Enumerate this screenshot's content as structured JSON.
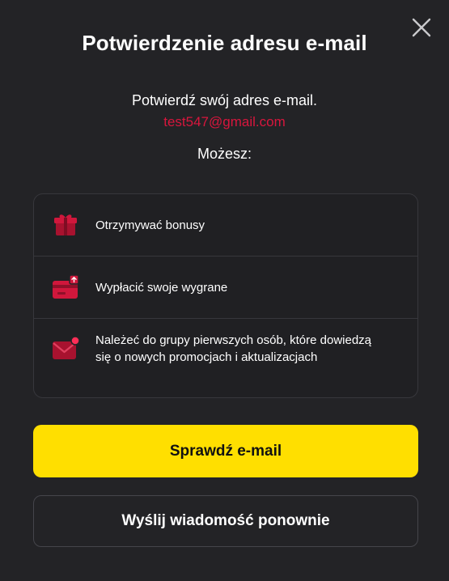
{
  "modal": {
    "title": "Potwierdzenie adresu e-mail",
    "subtitle": "Potwierdź swój adres e-mail.",
    "email": "test547@gmail.com",
    "can_label": "Możesz:",
    "close_icon": "close-icon"
  },
  "benefits": [
    {
      "icon": "gift-icon",
      "text": "Otrzymywać bonusy"
    },
    {
      "icon": "wallet-withdraw-icon",
      "text": "Wypłacić swoje wygrane"
    },
    {
      "icon": "mail-notification-icon",
      "text": "Należeć do grupy pierwszych osób, które dowiedzą się o nowych promocjach i aktualizacjach"
    }
  ],
  "buttons": {
    "primary": "Sprawdź e-mail",
    "secondary": "Wyślij wiadomość ponownie"
  },
  "colors": {
    "background": "#232326",
    "accent_yellow": "#ffdf00",
    "email_red": "#d8163d",
    "icon_red": "#d0173c"
  }
}
